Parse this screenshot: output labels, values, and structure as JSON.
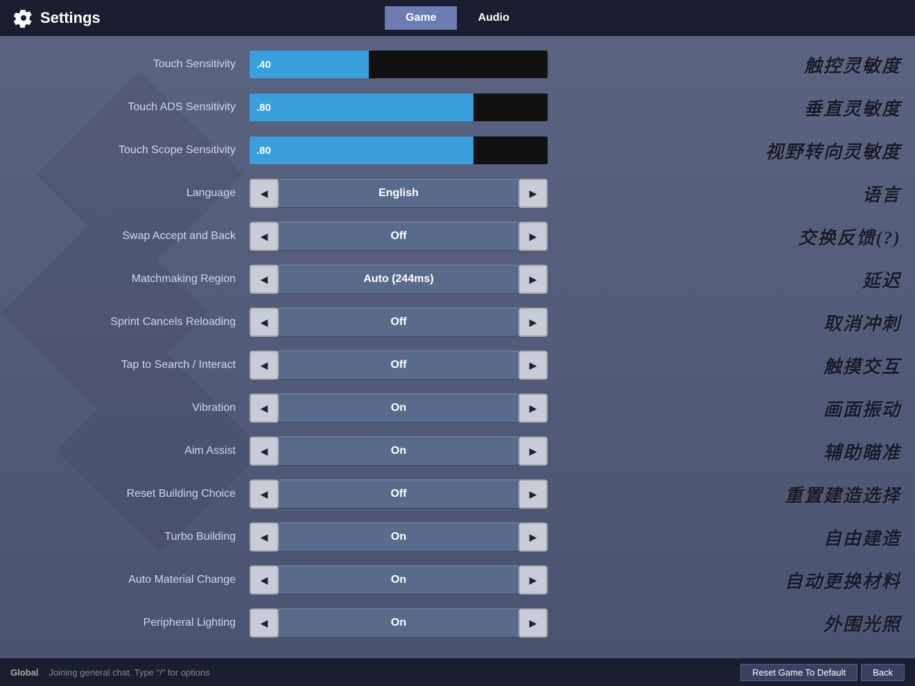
{
  "header": {
    "title": "Settings",
    "tabs": [
      {
        "id": "game",
        "label": "Game",
        "active": true
      },
      {
        "id": "audio",
        "label": "Audio",
        "active": false
      }
    ]
  },
  "settings": {
    "sliders": [
      {
        "id": "touch-sensitivity",
        "label": "Touch Sensitivity",
        "value": ".40",
        "fillPercent": 40,
        "chinese": "触控灵敏度"
      },
      {
        "id": "touch-ads-sensitivity",
        "label": "Touch ADS Sensitivity",
        "value": ".80",
        "fillPercent": 75,
        "chinese": "垂直灵敏度"
      },
      {
        "id": "touch-scope-sensitivity",
        "label": "Touch Scope Sensitivity",
        "value": ".80",
        "fillPercent": 75,
        "chinese": "视野转向灵敏度"
      }
    ],
    "toggles": [
      {
        "id": "language",
        "label": "Language",
        "value": "English",
        "chinese": "语言"
      },
      {
        "id": "swap-accept-back",
        "label": "Swap Accept and Back",
        "value": "Off",
        "chinese": "交换反馈(?)"
      },
      {
        "id": "matchmaking-region",
        "label": "Matchmaking Region",
        "value": "Auto (244ms)",
        "chinese": "延迟"
      },
      {
        "id": "sprint-cancels-reloading",
        "label": "Sprint Cancels Reloading",
        "value": "Off",
        "chinese": "取消冲刺"
      },
      {
        "id": "tap-to-search",
        "label": "Tap to Search / Interact",
        "value": "Off",
        "chinese": "触摸交互"
      },
      {
        "id": "vibration",
        "label": "Vibration",
        "value": "On",
        "chinese": "画面振动"
      },
      {
        "id": "aim-assist",
        "label": "Aim Assist",
        "value": "On",
        "chinese": "辅助瞄准"
      },
      {
        "id": "reset-building-choice",
        "label": "Reset Building Choice",
        "value": "Off",
        "chinese": "重置建造选择"
      },
      {
        "id": "turbo-building",
        "label": "Turbo Building",
        "value": "On",
        "chinese": "自由建造"
      },
      {
        "id": "auto-material-change",
        "label": "Auto Material Change",
        "value": "On",
        "chinese": "自动更换材料"
      },
      {
        "id": "peripheral-lighting",
        "label": "Peripheral Lighting",
        "value": "On",
        "chinese": "外围光照"
      }
    ]
  },
  "footer": {
    "global_label": "Global",
    "chat_text": "Joining general chat. Type \"/\" for options",
    "reset_btn": "Reset Game To Default",
    "back_btn": "Back"
  },
  "arrows": {
    "left": "◀",
    "right": "▶"
  }
}
